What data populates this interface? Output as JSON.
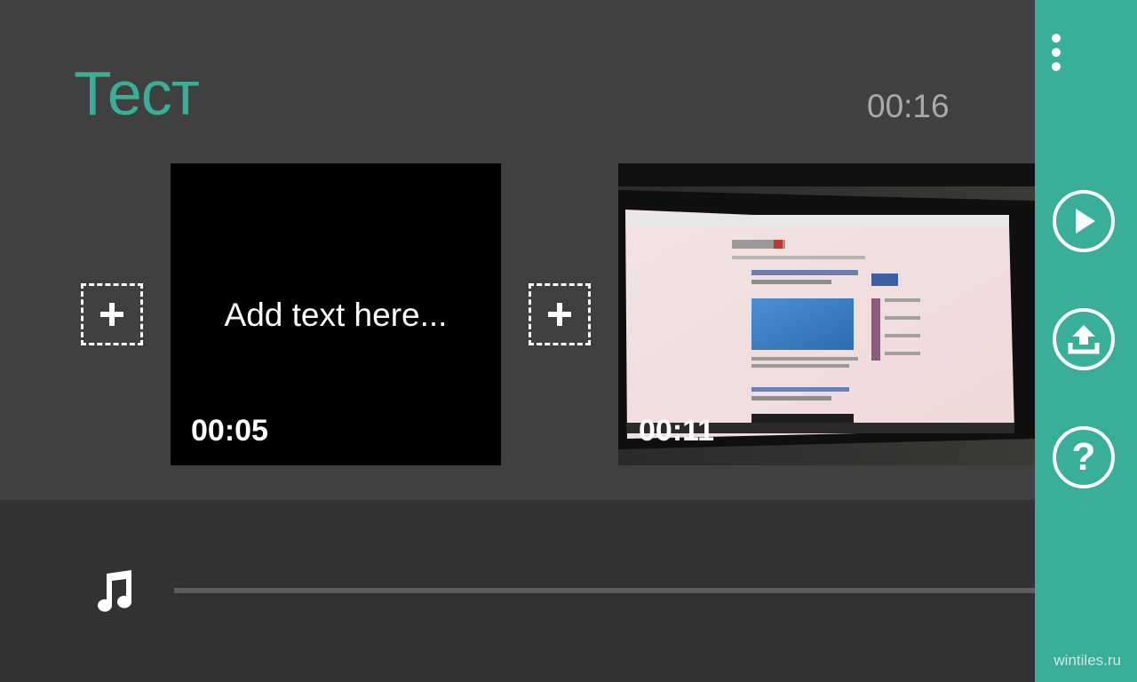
{
  "project": {
    "title": "Тест",
    "total_duration": "00:16"
  },
  "timeline": {
    "clips": [
      {
        "kind": "text",
        "caption": "Add text here...",
        "duration": "00:05"
      },
      {
        "kind": "video",
        "duration": "00:11"
      }
    ]
  },
  "sidebar": {
    "icons": {
      "more": "more-vertical-icon",
      "play": "play-icon",
      "share": "upload-icon",
      "help": "help-icon"
    },
    "help_glyph": "?"
  },
  "audio": {
    "icon": "music-note-icon"
  },
  "watermark": "wintiles.ru",
  "colors": {
    "accent": "#39ae98",
    "title": "#3aae98",
    "background": "#404040",
    "bottom_bar": "#323232"
  }
}
